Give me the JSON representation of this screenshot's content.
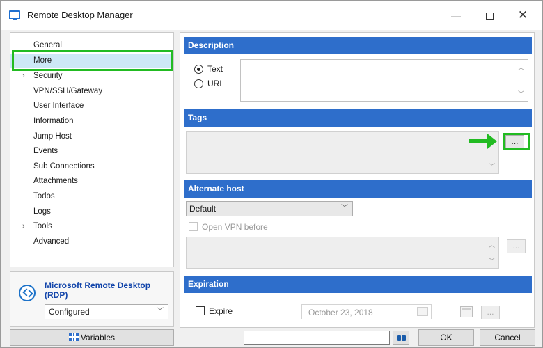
{
  "window": {
    "title": "Remote Desktop Manager"
  },
  "nav": {
    "items": [
      {
        "label": "General",
        "has_chevron": false
      },
      {
        "label": "More",
        "has_chevron": false,
        "selected": true
      },
      {
        "label": "Security",
        "has_chevron": true
      },
      {
        "label": "VPN/SSH/Gateway",
        "has_chevron": false
      },
      {
        "label": "User Interface",
        "has_chevron": false
      },
      {
        "label": "Information",
        "has_chevron": false
      },
      {
        "label": "Jump Host",
        "has_chevron": false
      },
      {
        "label": "Events",
        "has_chevron": false
      },
      {
        "label": "Sub Connections",
        "has_chevron": false
      },
      {
        "label": "Attachments",
        "has_chevron": false
      },
      {
        "label": "Todos",
        "has_chevron": false
      },
      {
        "label": "Logs",
        "has_chevron": false
      },
      {
        "label": "Tools",
        "has_chevron": true
      },
      {
        "label": "Advanced",
        "has_chevron": false
      }
    ]
  },
  "entry": {
    "name": "Microsoft Remote Desktop (RDP)",
    "status": "Configured"
  },
  "description": {
    "header": "Description",
    "option_text": "Text",
    "option_url": "URL",
    "selected": "Text"
  },
  "tags": {
    "header": "Tags",
    "browse_label": "..."
  },
  "alternate_host": {
    "header": "Alternate host",
    "select_value": "Default",
    "vpn_label": "Open VPN before",
    "browse_label": "..."
  },
  "expiration": {
    "header": "Expiration",
    "expire_label": "Expire",
    "date_value": "October   23, 2018",
    "browse_label": "..."
  },
  "footer": {
    "variables_label": "Variables",
    "ok_label": "OK",
    "cancel_label": "Cancel"
  },
  "glyphs": {
    "minimize": "—",
    "close": "✕",
    "chevron_right": "›",
    "chevron_down": "﹀",
    "scroll_up": "︿",
    "scroll_down": "﹀"
  },
  "colors": {
    "section_header": "#2e6ecb",
    "annotation_green": "#22bb22",
    "selected_item": "#cde8f6",
    "entry_name": "#1144aa"
  }
}
